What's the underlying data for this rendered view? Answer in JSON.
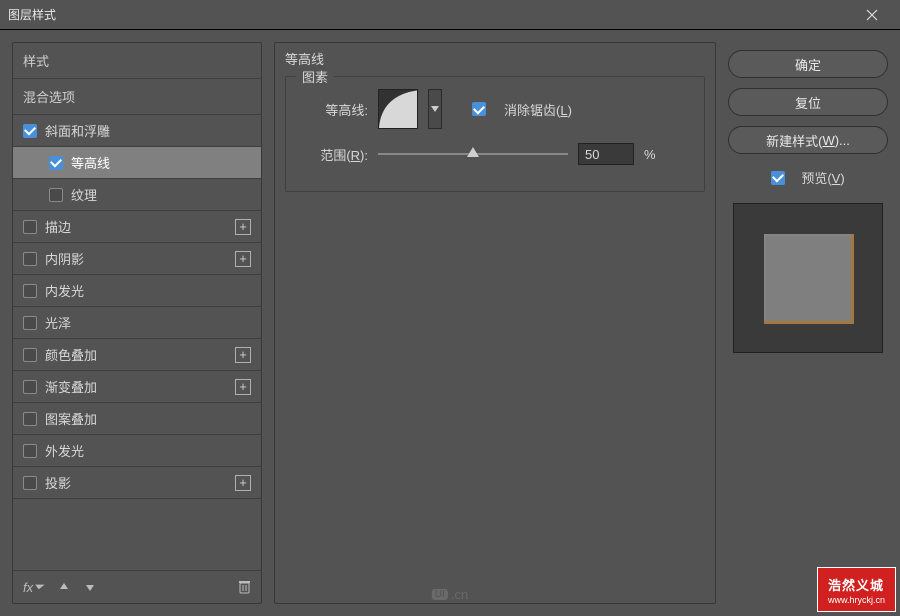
{
  "window": {
    "title": "图层样式"
  },
  "left": {
    "header_styles": "样式",
    "header_blend": "混合选项",
    "items": [
      {
        "label": "斜面和浮雕",
        "checked": true,
        "indent": false,
        "addable": false,
        "selected": false
      },
      {
        "label": "等高线",
        "checked": true,
        "indent": true,
        "addable": false,
        "selected": true
      },
      {
        "label": "纹理",
        "checked": false,
        "indent": true,
        "addable": false,
        "selected": false
      },
      {
        "label": "描边",
        "checked": false,
        "indent": false,
        "addable": true,
        "selected": false
      },
      {
        "label": "内阴影",
        "checked": false,
        "indent": false,
        "addable": true,
        "selected": false
      },
      {
        "label": "内发光",
        "checked": false,
        "indent": false,
        "addable": false,
        "selected": false
      },
      {
        "label": "光泽",
        "checked": false,
        "indent": false,
        "addable": false,
        "selected": false
      },
      {
        "label": "颜色叠加",
        "checked": false,
        "indent": false,
        "addable": true,
        "selected": false
      },
      {
        "label": "渐变叠加",
        "checked": false,
        "indent": false,
        "addable": true,
        "selected": false
      },
      {
        "label": "图案叠加",
        "checked": false,
        "indent": false,
        "addable": false,
        "selected": false
      },
      {
        "label": "外发光",
        "checked": false,
        "indent": false,
        "addable": false,
        "selected": false
      },
      {
        "label": "投影",
        "checked": false,
        "indent": false,
        "addable": true,
        "selected": false
      }
    ],
    "footer_fx": "fx"
  },
  "center": {
    "section_title": "等高线",
    "fieldset_title": "图素",
    "contour_label": "等高线:",
    "antialias_label_prefix": "消除锯齿(",
    "antialias_hotkey": "L",
    "antialias_label_suffix": ")",
    "antialias_checked": true,
    "range_label_prefix": "范围(",
    "range_hotkey": "R",
    "range_label_suffix": "):",
    "range_value": "50",
    "range_unit": "%"
  },
  "right": {
    "ok": "确定",
    "reset": "复位",
    "new_style_prefix": "新建样式(",
    "new_style_hotkey": "W",
    "new_style_suffix": ")...",
    "preview_prefix": "预览(",
    "preview_hotkey": "V",
    "preview_suffix": ")",
    "preview_checked": true
  },
  "watermark": {
    "text": "浩然义城",
    "url": "www.hryckj.cn"
  },
  "logo": {
    "badge": "UI",
    "suffix": ".cn"
  }
}
